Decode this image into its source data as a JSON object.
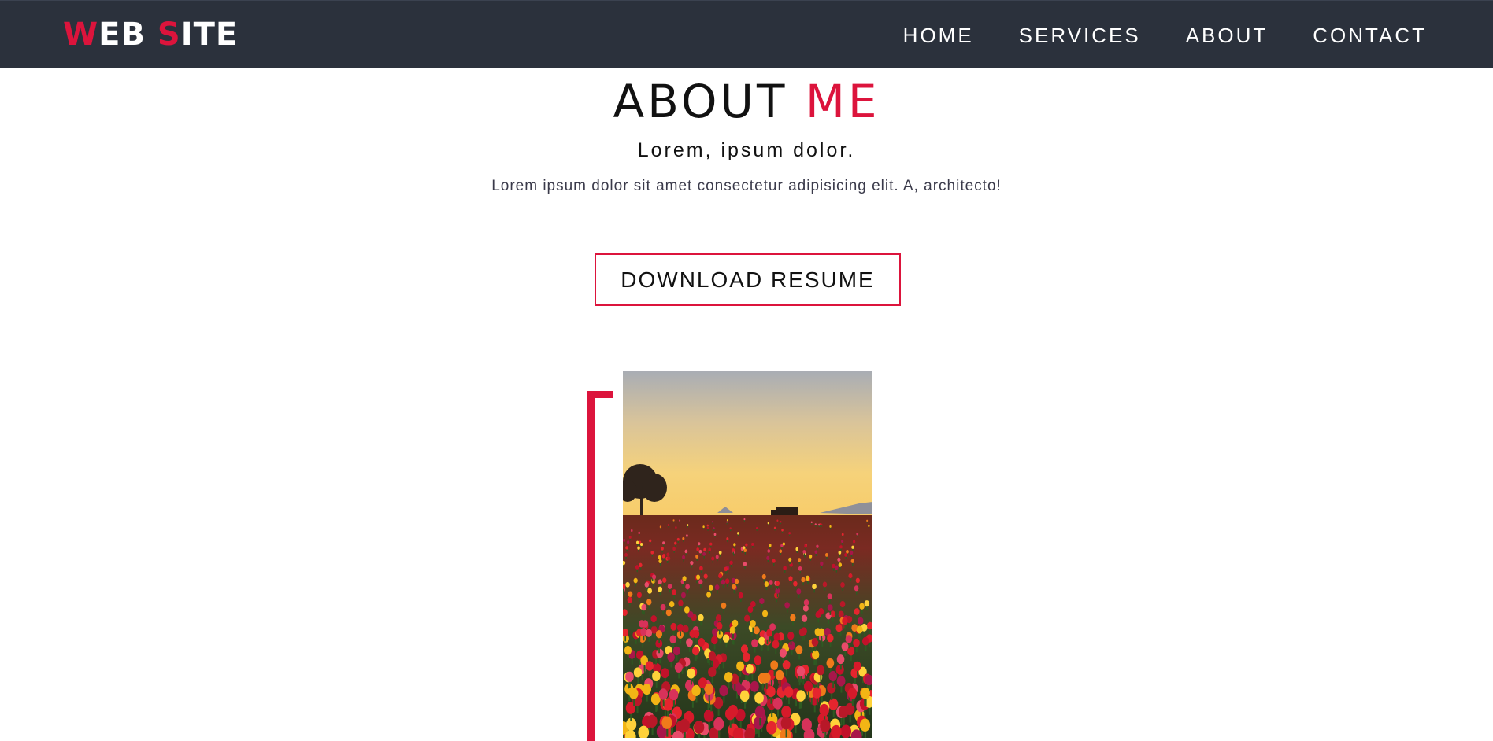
{
  "header": {
    "logo": {
      "part1_accent": "W",
      "part1_rest": "EB ",
      "part2_accent": "S",
      "part2_rest": "ITE"
    },
    "nav": [
      {
        "label": "HOME"
      },
      {
        "label": "SERVICES"
      },
      {
        "label": "ABOUT"
      },
      {
        "label": "CONTACT"
      }
    ]
  },
  "about": {
    "heading_main": "ABOUT ",
    "heading_accent": "ME",
    "subtitle": "Lorem, ipsum dolor.",
    "description": "Lorem ipsum dolor sit amet consectetur adipisicing elit. A, architecto!",
    "button_label": "DOWNLOAD RESUME",
    "image": "tulip-field-sunset-photo"
  },
  "colors": {
    "accent": "#dc143c",
    "navbar": "#2b313c",
    "text": "#111111"
  }
}
